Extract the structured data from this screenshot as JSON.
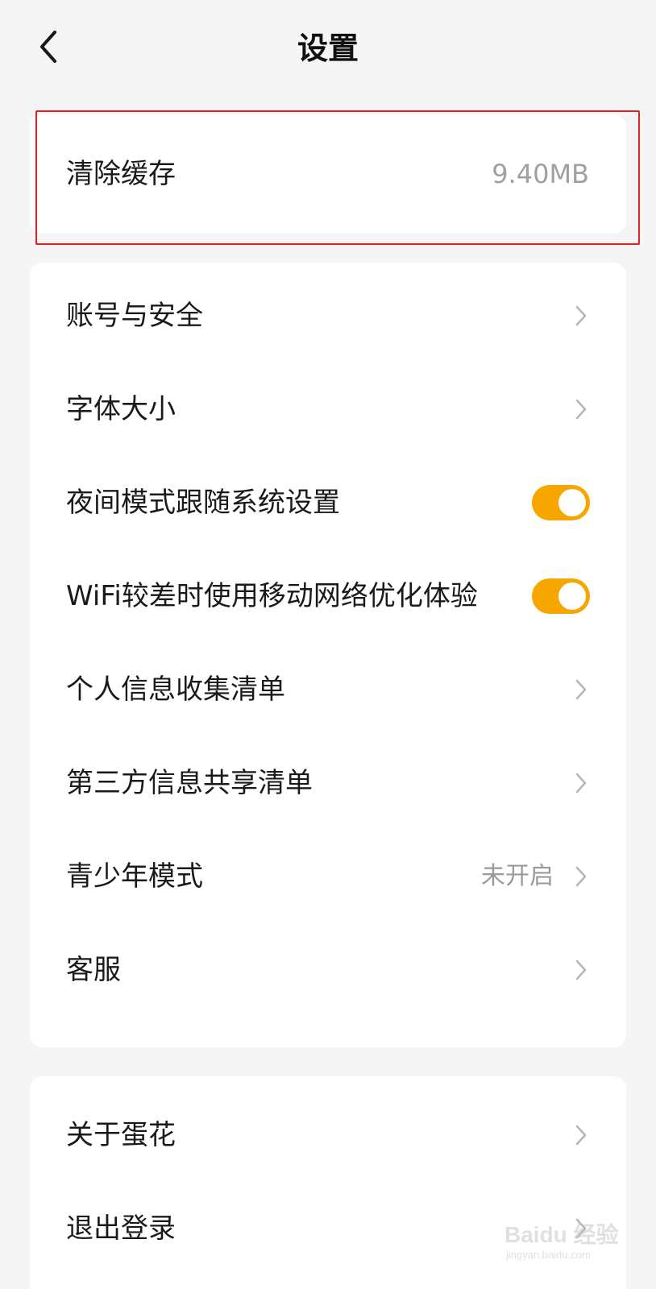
{
  "header": {
    "title": "设置",
    "back_icon": "chevron-left-icon"
  },
  "cache": {
    "label": "清除缓存",
    "value": "9.40MB"
  },
  "main_items": [
    {
      "label": "账号与安全",
      "type": "link"
    },
    {
      "label": "字体大小",
      "type": "link"
    },
    {
      "label": "夜间模式跟随系统设置",
      "type": "toggle",
      "on": true
    },
    {
      "label": "WiFi较差时使用移动网络优化体验",
      "type": "toggle",
      "on": true
    },
    {
      "label": "个人信息收集清单",
      "type": "link"
    },
    {
      "label": "第三方信息共享清单",
      "type": "link"
    },
    {
      "label": "青少年模式",
      "type": "link",
      "value": "未开启"
    },
    {
      "label": "客服",
      "type": "link"
    }
  ],
  "bottom_items": [
    {
      "label": "关于蛋花",
      "type": "link"
    },
    {
      "label": "退出登录",
      "type": "link"
    }
  ],
  "colors": {
    "background": "#f5f5f5",
    "card": "#ffffff",
    "toggle_on": "#f7a600",
    "highlight": "#e02020",
    "secondary_text": "#9a9a9a"
  },
  "watermark": {
    "brand": "Baidu 经验",
    "url": "jingyan.baidu.com"
  }
}
